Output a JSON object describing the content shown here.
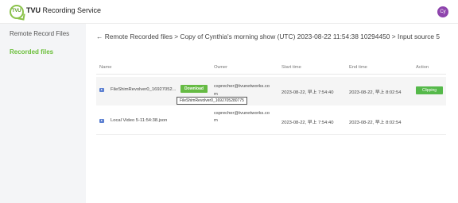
{
  "app": {
    "title_prefix": "TVU",
    "title_rest": " Recording Service",
    "logo_text": "TVU",
    "avatar_initials": "Cy"
  },
  "sidebar": {
    "items": [
      {
        "label": "Remote Record Files"
      },
      {
        "label": "Recorded files"
      }
    ]
  },
  "breadcrumb": "← Remote Recorded files > Copy of Cynthia's morning show (UTC) 2023-08-22 11:54:38 10294450 > Input source 5",
  "table": {
    "headers": {
      "name": "Name",
      "owner": "Owner",
      "start": "Start time",
      "end": "End time",
      "action": "Action"
    },
    "rows": [
      {
        "name": "FileShimRevolver0_16927052...",
        "owner_line1": "csprecher@tvunetworks.co",
        "owner_line2": "m",
        "start": "2023-08-22, 早上 7:54:40",
        "end": "2023-08-22, 早上 8:02:54",
        "download_label": "Download",
        "tooltip": "FileShimRevolver0_1692705280775",
        "action_label": "Clipping"
      },
      {
        "name": "Local Video 5-11:54:38.json",
        "owner_line1": "csprecher@tvunetworks.co",
        "owner_line2": "m",
        "start": "2023-08-22, 早上 7:54:40",
        "end": "2023-08-22, 早上 8:02:54"
      }
    ]
  },
  "colors": {
    "accent": "#6bbf3a",
    "button": "#66bb44",
    "avatar": "#8e44ad",
    "file_icon": "#5b7fd1"
  }
}
